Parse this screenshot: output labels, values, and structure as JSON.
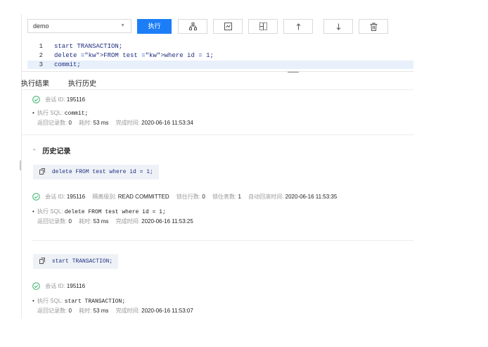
{
  "toolbar": {
    "database": "demo",
    "execute_label": "执行",
    "buttons": [
      {
        "icon": "sitemap-icon"
      },
      {
        "icon": "chart-box-icon"
      },
      {
        "icon": "table-layout-icon"
      },
      {
        "icon": "arrow-up-icon"
      },
      {
        "icon": "arrow-down-icon"
      },
      {
        "icon": "trash-icon"
      }
    ]
  },
  "editor": {
    "lines": [
      {
        "no": "1",
        "text": "start TRANSACTION;"
      },
      {
        "no": "2",
        "text": "delete FROM test where id = 1;"
      },
      {
        "no": "3",
        "text": "commit;"
      }
    ]
  },
  "tabs": {
    "results": "执行结果",
    "history": "执行历史"
  },
  "labels": {
    "session_id": "会话 ID:",
    "exec_sql": "执行 SQL:",
    "rows_returned": "返回记录数:",
    "elapsed": "耗时:",
    "completed_at": "完成时间:",
    "isolation": "隔离级别:",
    "locked_rows": "锁住行数:",
    "locked_tables": "锁住表数:",
    "auto_rollback": "自动回滚时间:"
  },
  "result": {
    "session_id": "195116",
    "sql": "commit;",
    "rows": "0",
    "elapsed": "53 ms",
    "completed_at": "2020-06-16 11:53:34"
  },
  "history": {
    "title": "历史记录",
    "entries": [
      {
        "sql": "delete FROM test where id = 1;",
        "session_id": "195116",
        "isolation": "READ COMMITTED",
        "locked_rows": "0",
        "locked_tables": "1",
        "auto_rollback": "2020-06-16 11:53:35",
        "rows": "0",
        "elapsed": "53 ms",
        "completed_at": "2020-06-16 11:53:25"
      },
      {
        "sql": "start TRANSACTION;",
        "session_id": "195116",
        "rows": "0",
        "elapsed": "53 ms",
        "completed_at": "2020-06-16 11:53:07"
      }
    ]
  },
  "colors": {
    "accent": "#1c7ef7",
    "success": "#3cb371",
    "keyword": "#1a3fc8",
    "chip_bg": "#eef2f7"
  }
}
